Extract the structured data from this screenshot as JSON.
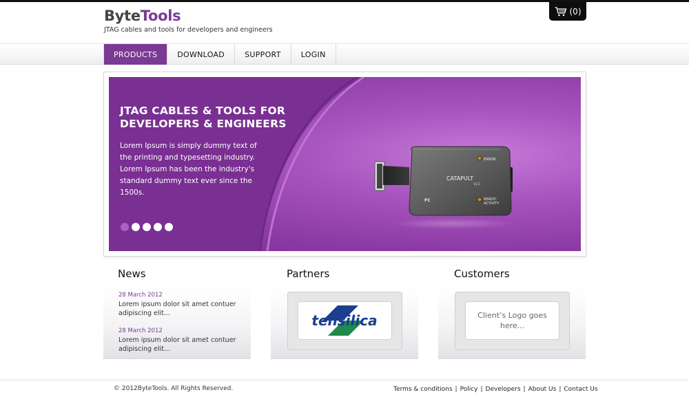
{
  "brand": {
    "name_part1": "Byte",
    "name_part2": "Tools",
    "tagline": "JTAG cables and tools for developers and engineers",
    "accent_color": "#7b3a93"
  },
  "cart": {
    "icon": "cart-icon",
    "count": "(0)"
  },
  "nav": {
    "items": [
      {
        "label": "PRODUCTS",
        "active": true
      },
      {
        "label": "DOWNLOAD",
        "active": false
      },
      {
        "label": "SUPPORT",
        "active": false
      },
      {
        "label": "LOGIN",
        "active": false
      }
    ]
  },
  "slider": {
    "title_line1": "JTAG CABLES & TOOLS FOR",
    "title_line2": "DEVELOPERS & ENGINEERS",
    "text": "Lorem Ipsum is simply dummy text of the printing and typesetting industry. Lorem Ipsum has been the industry's standard dummy text ever since the 1500s.",
    "device": {
      "name": "CATAPULT",
      "model": "EJ-2",
      "label_error": "ERROR",
      "label_ready": "READY/",
      "label_activity": "ACTIVITY",
      "label_fc": "FC"
    },
    "dots": 5,
    "active_dot": 1
  },
  "sections": {
    "news": {
      "title": "News",
      "items": [
        {
          "date": "28 March 2012",
          "text": "Lorem ipsum dolor sit amet contuer adipiscing elit..."
        },
        {
          "date": "28 March 2012",
          "text": "Lorem ipsum dolor sit amet contuer adipiscing elit..."
        }
      ]
    },
    "partners": {
      "title": "Partners",
      "logo_text": "tensilica"
    },
    "customers": {
      "title": "Customers",
      "placeholder": "Client’s Logo goes here..."
    }
  },
  "footer": {
    "copyright": "© 2012ByteTools. All Rights Reserved.",
    "links": [
      "Terms & conditions",
      "Policy",
      "Developers",
      "About Us",
      "Contact Us"
    ]
  }
}
